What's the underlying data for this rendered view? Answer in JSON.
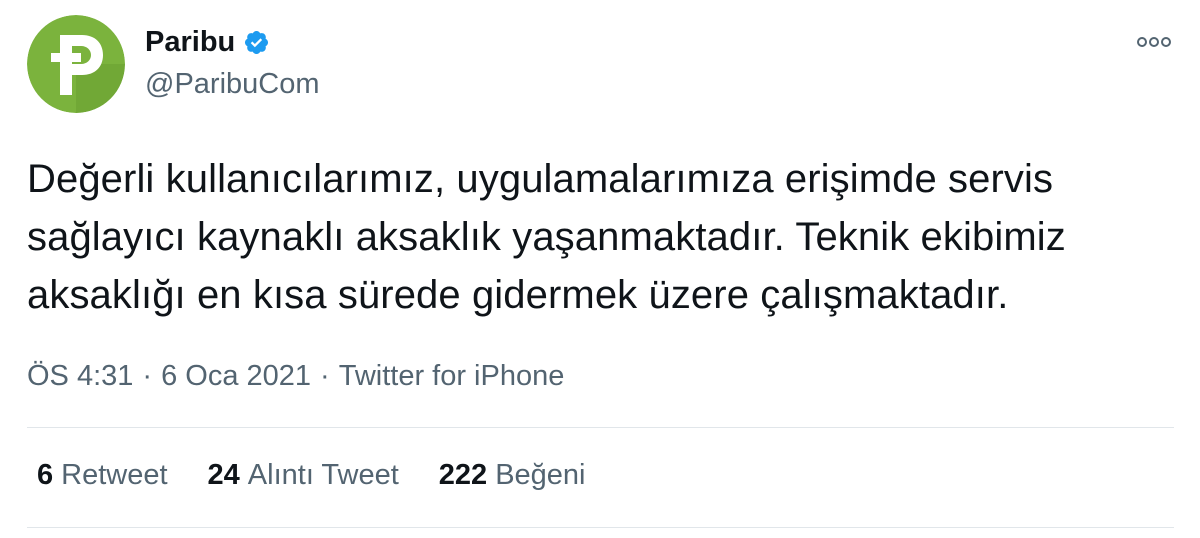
{
  "author": {
    "name": "Paribu",
    "handle": "@ParibuCom",
    "avatar_icon": "paribu-logo-icon",
    "avatar_color": "#7bb33d",
    "verified_color": "#1d9bf0"
  },
  "tweet": {
    "lines": [
      "Değerli kullanıcılarımız, uygulamalarımıza erişimde servis",
      "sağlayıcı kaynaklı aksaklık yaşanmaktadır. Teknik ekibimiz",
      "aksaklığı en kısa sürede gidermek üzere çalışmaktadır."
    ]
  },
  "meta": {
    "time": "ÖS 4:31",
    "separator": "·",
    "date": "6 Oca 2021",
    "source": "Twitter for iPhone"
  },
  "stats": [
    {
      "count": "6",
      "label": "Retweet"
    },
    {
      "count": "24",
      "label": "Alıntı Tweet"
    },
    {
      "count": "222",
      "label": "Beğeni"
    }
  ],
  "menu_icon": "more-options-icon"
}
